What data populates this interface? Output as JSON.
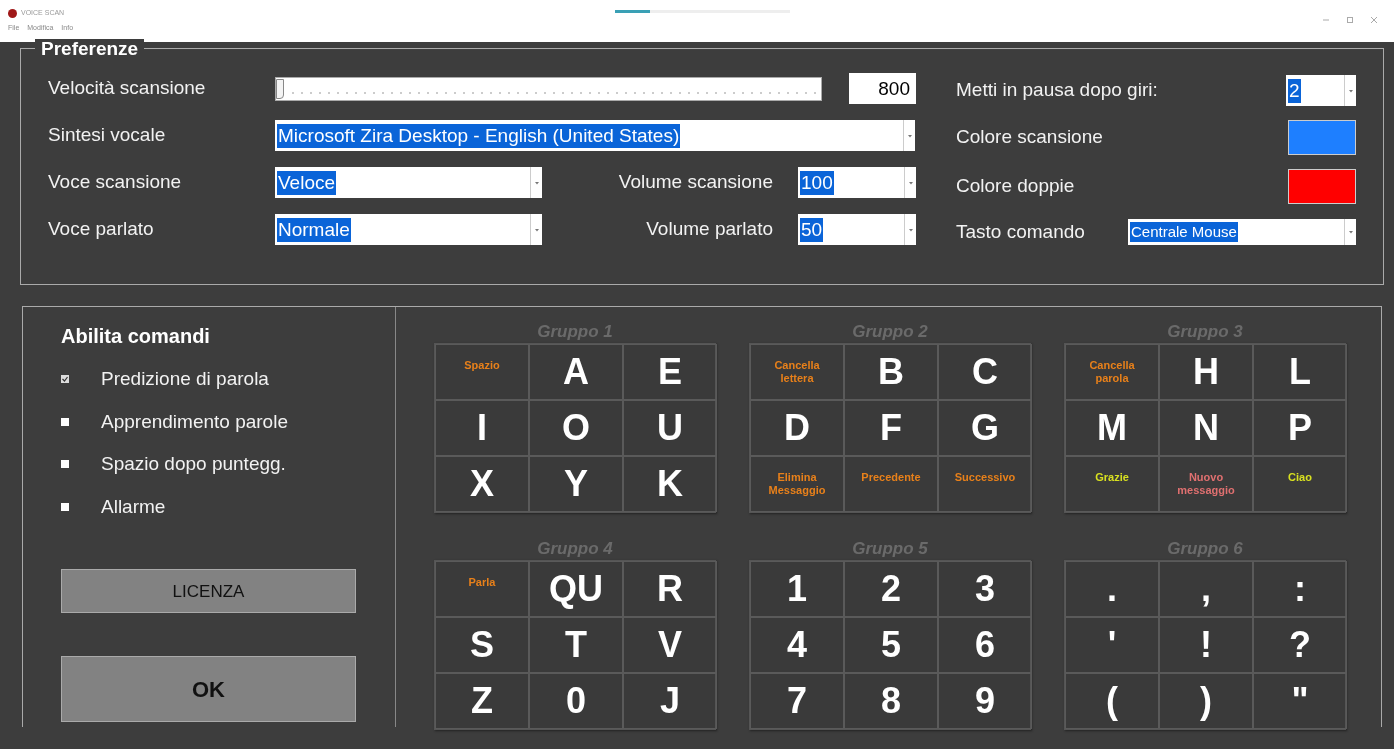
{
  "window": {
    "title": "VOICE SCAN",
    "menu": [
      "File",
      "Modifica",
      "Info"
    ],
    "loading": {
      "level": 0.2
    }
  },
  "preferences": {
    "title": "Preferenze",
    "speed": {
      "label": "Velocità scansione",
      "level": 0,
      "value": "800"
    },
    "voice_synth": {
      "label": "Sintesi vocale",
      "value": "Microsoft Zira Desktop - English (United States)"
    },
    "scan_voice": {
      "label": "Voce scansione",
      "value": "Veloce"
    },
    "scan_volume": {
      "label": "Volume scansione",
      "value": "100"
    },
    "spoken_voice": {
      "label": "Voce parlato",
      "value": "Normale"
    },
    "spoken_volume": {
      "label": "Volume parlato",
      "value": "50"
    },
    "pause": {
      "label": "Metti in pausa dopo giri:",
      "value": "2"
    },
    "scan_color": {
      "label": "Colore scansione",
      "color": "#1e7fff"
    },
    "double_color": {
      "label": "Colore doppie",
      "color": "#ff0000"
    },
    "command_key": {
      "label": "Tasto comando",
      "value": "Centrale Mouse"
    }
  },
  "commands": {
    "title": "Abilita comandi",
    "options": [
      {
        "label": "Predizione di parola",
        "checked": true
      },
      {
        "label": "Apprendimento parole",
        "checked": false
      },
      {
        "label": "Spazio dopo puntegg.",
        "checked": false
      },
      {
        "label": "Allarme",
        "checked": false
      }
    ],
    "buttons": [
      {
        "label": "LICENZA",
        "kind": "small"
      },
      {
        "label": "OK",
        "kind": "large"
      }
    ]
  },
  "groups": [
    {
      "title": "Gruppo 1",
      "cells": [
        {
          "text": "Spazio",
          "kind": "command",
          "color": "#e8801a"
        },
        {
          "text": "A",
          "kind": "letter"
        },
        {
          "text": "E",
          "kind": "letter"
        },
        {
          "text": "I",
          "kind": "letter"
        },
        {
          "text": "O",
          "kind": "letter"
        },
        {
          "text": "U",
          "kind": "letter"
        },
        {
          "text": "X",
          "kind": "letter"
        },
        {
          "text": "Y",
          "kind": "letter"
        },
        {
          "text": "K",
          "kind": "letter"
        }
      ]
    },
    {
      "title": "Gruppo 2",
      "cells": [
        {
          "text": "Cancella lettera",
          "kind": "command",
          "color": "#e8801a"
        },
        {
          "text": "B",
          "kind": "letter"
        },
        {
          "text": "C",
          "kind": "letter"
        },
        {
          "text": "D",
          "kind": "letter"
        },
        {
          "text": "F",
          "kind": "letter"
        },
        {
          "text": "G",
          "kind": "letter"
        },
        {
          "text": "Elimina Messaggio",
          "kind": "command",
          "color": "#e8801a"
        },
        {
          "text": "Precedente",
          "kind": "command",
          "color": "#e8801a"
        },
        {
          "text": "Successivo",
          "kind": "command",
          "color": "#e8801a"
        }
      ]
    },
    {
      "title": "Gruppo 3",
      "cells": [
        {
          "text": "Cancella parola",
          "kind": "command",
          "color": "#e8801a"
        },
        {
          "text": "H",
          "kind": "letter"
        },
        {
          "text": "L",
          "kind": "letter"
        },
        {
          "text": "M",
          "kind": "letter"
        },
        {
          "text": "N",
          "kind": "letter"
        },
        {
          "text": "P",
          "kind": "letter"
        },
        {
          "text": "Grazie",
          "kind": "command",
          "color": "#d8e020"
        },
        {
          "text": "Nuovo messaggio",
          "kind": "command",
          "color": "#e07070"
        },
        {
          "text": "Ciao",
          "kind": "command",
          "color": "#d8e020"
        }
      ]
    },
    {
      "title": "Gruppo 4",
      "cells": [
        {
          "text": "Parla",
          "kind": "command",
          "color": "#e8801a"
        },
        {
          "text": "QU",
          "kind": "letter"
        },
        {
          "text": "R",
          "kind": "letter"
        },
        {
          "text": "S",
          "kind": "letter"
        },
        {
          "text": "T",
          "kind": "letter"
        },
        {
          "text": "V",
          "kind": "letter"
        },
        {
          "text": "Z",
          "kind": "letter"
        },
        {
          "text": "0",
          "kind": "letter"
        },
        {
          "text": "J",
          "kind": "letter"
        }
      ]
    },
    {
      "title": "Gruppo 5",
      "cells": [
        {
          "text": "1",
          "kind": "letter"
        },
        {
          "text": "2",
          "kind": "letter"
        },
        {
          "text": "3",
          "kind": "letter"
        },
        {
          "text": "4",
          "kind": "letter"
        },
        {
          "text": "5",
          "kind": "letter"
        },
        {
          "text": "6",
          "kind": "letter"
        },
        {
          "text": "7",
          "kind": "letter"
        },
        {
          "text": "8",
          "kind": "letter"
        },
        {
          "text": "9",
          "kind": "letter"
        }
      ]
    },
    {
      "title": "Gruppo 6",
      "cells": [
        {
          "text": ".",
          "kind": "letter"
        },
        {
          "text": ",",
          "kind": "letter"
        },
        {
          "text": ":",
          "kind": "letter"
        },
        {
          "text": "'",
          "kind": "letter"
        },
        {
          "text": "!",
          "kind": "letter"
        },
        {
          "text": "?",
          "kind": "letter"
        },
        {
          "text": "(",
          "kind": "letter"
        },
        {
          "text": ")",
          "kind": "letter"
        },
        {
          "text": "\"",
          "kind": "letter"
        }
      ]
    }
  ]
}
